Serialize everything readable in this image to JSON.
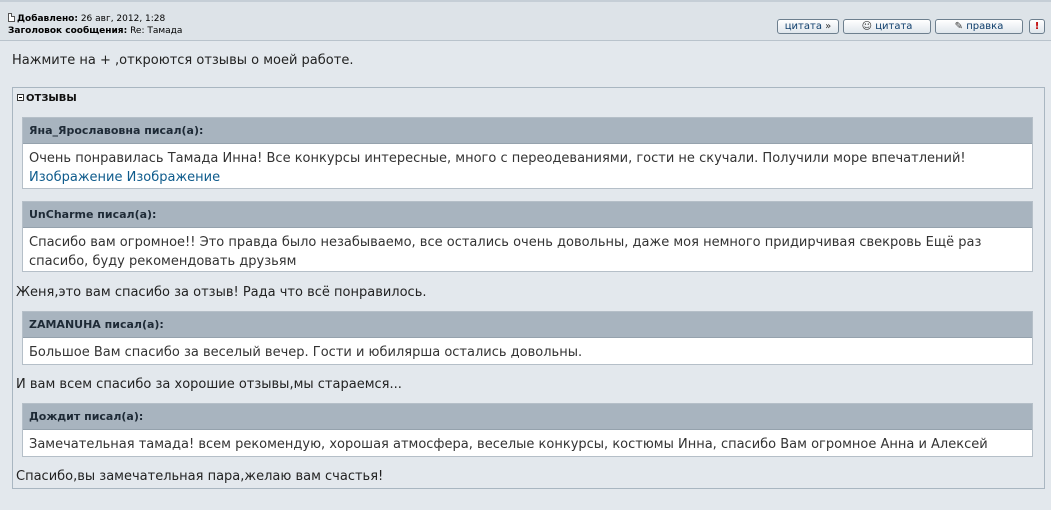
{
  "header": {
    "added_label": "Добавлено:",
    "added_value": "26 авг, 2012, 1:28",
    "subject_label": "Заголовок сообщения:",
    "subject_value": "Re: Тамада"
  },
  "buttons": {
    "quote_multi": "цитата",
    "quote": "цитата",
    "edit": "правка",
    "report": "!"
  },
  "post": {
    "intro": "Нажмите на + ,откроются отзывы о моей работе.",
    "spoiler_title": "ОТЗЫВЫ",
    "quotes": [
      {
        "author": "Яна_Ярославовна писал(а):",
        "text": "Очень понравилась Тамада Инна! Все конкурсы интересные, много с переодеваниями, гости не скучали. Получили море впечатлений!",
        "links": "Изображение Изображение"
      },
      {
        "author": "UnCharme писал(а):",
        "text": "Спасибо вам огромное!! Это правда было незабываемо, все остались очень довольны, даже моя немного придирчивая свекровь Ещё раз спасибо, буду рекомендовать друзьям"
      },
      {
        "author": "ZAMANUHA писал(а):",
        "text": "Большое Вам спасибо за веселый вечер. Гости и юбилярша остались довольны."
      },
      {
        "author": "Дождит писал(а):",
        "text": "Замечательная тамада! всем рекомендую, хорошая атмосфера, веселые конкурсы, костюмы Инна, спасибо Вам огромное Анна и Алексей"
      }
    ],
    "replies": [
      "Женя,это вам спасибо за отзыв! Рада что всё понравилось.",
      "И вам всем спасибо за хорошие отзывы,мы стараемся...",
      "Спасибо,вы замечательная пара,желаю вам счастья!"
    ]
  },
  "colors": {
    "quote_header": "#a8b4bf",
    "background": "#e3e8ed",
    "link": "#0e5b8c"
  }
}
